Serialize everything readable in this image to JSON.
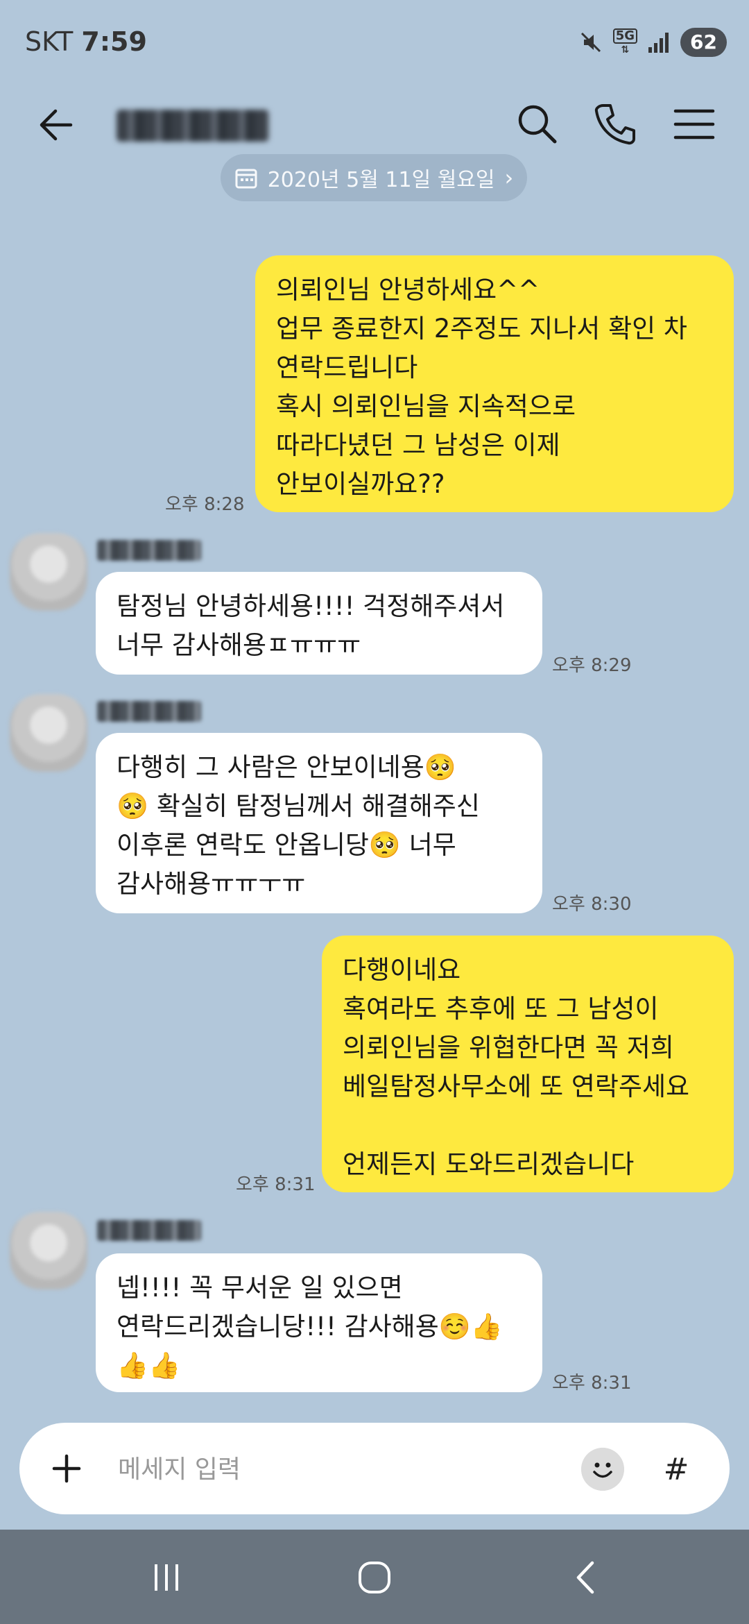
{
  "status": {
    "carrier": "SKT",
    "time": "7:59",
    "network": "5G",
    "battery": "62"
  },
  "header": {
    "title": "",
    "back_icon": "arrow-left-icon",
    "search_icon": "search-icon",
    "call_icon": "phone-icon",
    "menu_icon": "hamburger-menu-icon"
  },
  "date_divider": "2020년 5월 11일 월요일",
  "messages": [
    {
      "from": "me",
      "text": "의뢰인님 안녕하세요^^\n업무 종료한지 2주정도 지나서 확인 차\n연락드립니다\n혹시 의뢰인님을 지속적으로\n따라다녔던 그 남성은 이제\n안보이실까요??",
      "time": "오후 8:28"
    },
    {
      "from": "them",
      "text": "탐정님 안녕하세용!!!! 걱정해주셔서\n너무 감사해용ㅍㅠㅠㅠ",
      "time": "오후 8:29"
    },
    {
      "from": "them",
      "text": "다행히 그 사람은 안보이네용🥺\n🥺 확실히 탐정님께서 해결해주신\n이후론 연락도 안옵니당🥺 너무\n감사해용ㅠㅠㅜㅠ",
      "time": "오후 8:30"
    },
    {
      "from": "me",
      "text": "다행이네요\n혹여라도 추후에 또 그 남성이\n의뢰인님을 위협한다면 꼭 저희\n베일탐정사무소에 또 연락주세요\n\n언제든지 도와드리겠습니다",
      "time": "오후 8:31"
    },
    {
      "from": "them",
      "text": "넵!!!! 꼭 무서운 일 있으면\n연락드리겠습니당!!! 감사해용☺️👍\n👍👍",
      "time": "오후 8:31"
    }
  ],
  "composer": {
    "placeholder": "메세지 입력",
    "hash_label": "#"
  },
  "colors": {
    "background": "#b2c7da",
    "my_bubble": "#fee93f",
    "their_bubble": "#ffffff",
    "navbar": "#69747f"
  }
}
